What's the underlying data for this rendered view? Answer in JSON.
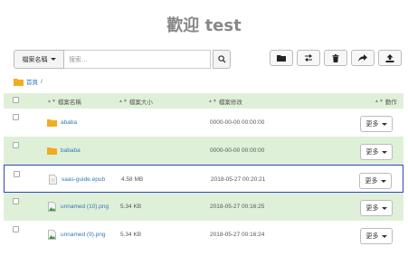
{
  "header": {
    "title": "歡迎 test"
  },
  "search": {
    "field_selector_label": "檔案名稱",
    "placeholder": "搜索...",
    "value": ""
  },
  "toolbar": {
    "actions": [
      {
        "icon": "folder-icon"
      },
      {
        "icon": "swap-icon"
      },
      {
        "icon": "trash-icon"
      },
      {
        "icon": "share-forward-icon"
      },
      {
        "icon": "upload-icon"
      }
    ]
  },
  "breadcrumb": {
    "home_label": "首頁",
    "separator": "/"
  },
  "table": {
    "columns": {
      "name": "檔案名稱",
      "size": "檔案大小",
      "modified": "檔案修改",
      "actions": "動作"
    },
    "rows": [
      {
        "type": "folder",
        "icon": "folder-icon",
        "name": "ababa",
        "size": "",
        "modified": "0000-00-00 00:00:00",
        "action": "更多"
      },
      {
        "type": "folder",
        "icon": "folder-icon",
        "name": "bababa",
        "size": "",
        "modified": "0000-00-00 00:00:00",
        "action": "更多"
      },
      {
        "type": "file",
        "icon": "document-icon",
        "name": "saas-guide.epub",
        "size": "4.58 MB",
        "modified": "2018-05-27 00:20:21",
        "action": "更多"
      },
      {
        "type": "image",
        "icon": "image-file-icon",
        "name": "unnamed (10).png",
        "size": "5.34 KB",
        "modified": "2018-05-27 00:16:25",
        "action": "更多"
      },
      {
        "type": "image",
        "icon": "image-file-icon",
        "name": "unnamed (9).png",
        "size": "5.34 KB",
        "modified": "2018-05-27 00:16:24",
        "action": "更多"
      }
    ]
  },
  "colors": {
    "row_highlight": "#dff0d8",
    "link": "#337ab7",
    "selection_border": "#2f47b8",
    "folder": "#f0ad1e"
  }
}
